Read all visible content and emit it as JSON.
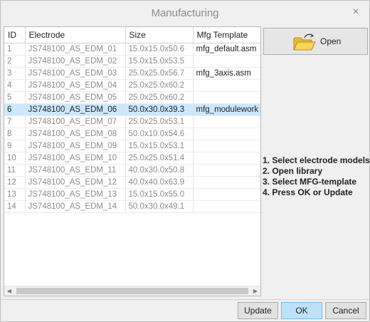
{
  "window": {
    "title": "Manufacturing",
    "close_glyph": "×"
  },
  "table": {
    "columns": [
      "ID",
      "Electrode",
      "Size",
      "Mfg Template"
    ],
    "rows": [
      {
        "id": "1",
        "electrode": "JS748100_AS_EDM_01",
        "size": "15.0x15.0x50.6",
        "mfg": "mfg_default.asm"
      },
      {
        "id": "2",
        "electrode": "JS748100_AS_EDM_02",
        "size": "15.0x15.0x53.5",
        "mfg": ""
      },
      {
        "id": "3",
        "electrode": "JS748100_AS_EDM_03",
        "size": "25.0x25.0x56.7",
        "mfg": "mfg_3axis.asm"
      },
      {
        "id": "4",
        "electrode": "JS748100_AS_EDM_04",
        "size": "25.0x25.0x60.2",
        "mfg": ""
      },
      {
        "id": "5",
        "electrode": "JS748100_AS_EDM_05",
        "size": "25.0x25.0x60.2",
        "mfg": ""
      },
      {
        "id": "6",
        "electrode": "JS748100_AS_EDM_06",
        "size": "50.0x30.0x39.3",
        "mfg": "mfg_modulework"
      },
      {
        "id": "7",
        "electrode": "JS748100_AS_EDM_07",
        "size": "25.0x25.0x53.1",
        "mfg": ""
      },
      {
        "id": "8",
        "electrode": "JS748100_AS_EDM_08",
        "size": "50.0x10.0x54.6",
        "mfg": ""
      },
      {
        "id": "9",
        "electrode": "JS748100_AS_EDM_09",
        "size": "15.0x15.0x53.1",
        "mfg": ""
      },
      {
        "id": "10",
        "electrode": "JS748100_AS_EDM_10",
        "size": "25.0x25.0x51.4",
        "mfg": ""
      },
      {
        "id": "11",
        "electrode": "JS748100_AS_EDM_11",
        "size": "40.0x30.0x50.8",
        "mfg": ""
      },
      {
        "id": "12",
        "electrode": "JS748100_AS_EDM_12",
        "size": "40.0x40.0x63.9",
        "mfg": ""
      },
      {
        "id": "13",
        "electrode": "JS748100_AS_EDM_13",
        "size": "15.0x15.0x55.0",
        "mfg": ""
      },
      {
        "id": "14",
        "electrode": "JS748100_AS_EDM_14",
        "size": "50.0x30.0x49.1",
        "mfg": ""
      }
    ],
    "selected_index": 5,
    "scroll": {
      "left_glyph": "◀",
      "right_glyph": "▶"
    }
  },
  "open_button": {
    "label": "Open",
    "icon": "open-folder-icon"
  },
  "instructions": [
    "1. Select electrode models",
    "2. Open library",
    "3. Select MFG-template",
    "4. Press OK or Update"
  ],
  "footer": {
    "update_label": "Update",
    "ok_label": "OK",
    "cancel_label": "Cancel"
  },
  "colors": {
    "selection": "#cce8ff",
    "ok_button": "#bfe2fb",
    "folder": "#f5c842"
  }
}
